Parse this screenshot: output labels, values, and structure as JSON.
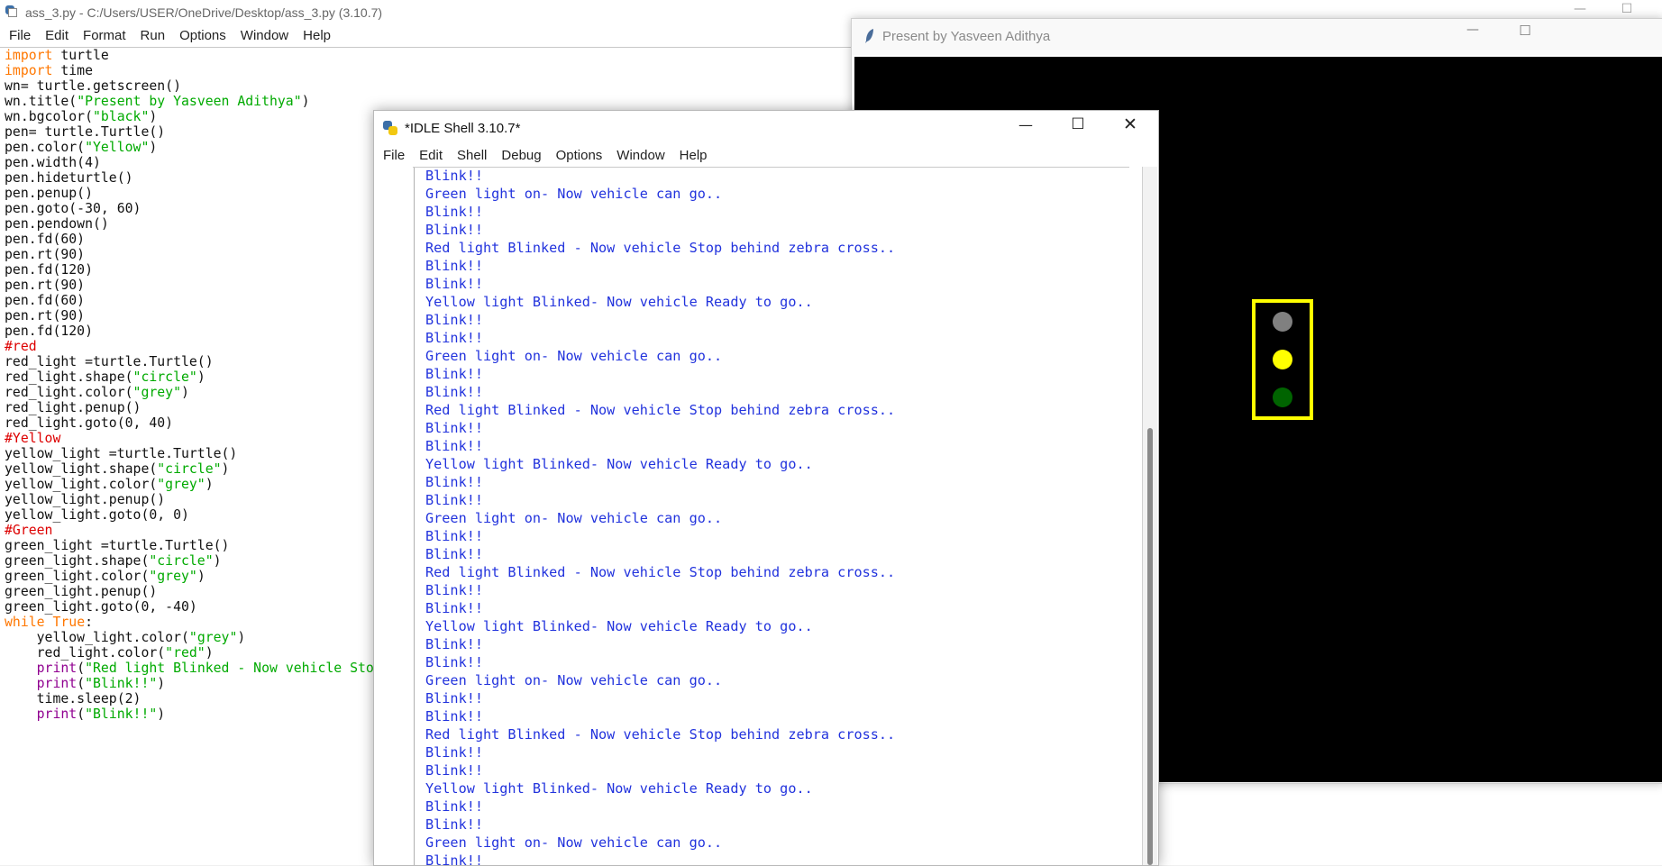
{
  "editor": {
    "title": "ass_3.py - C:/Users/USER/OneDrive/Desktop/ass_3.py (3.10.7)",
    "menu": [
      "File",
      "Edit",
      "Format",
      "Run",
      "Options",
      "Window",
      "Help"
    ],
    "code": [
      [
        [
          "kw",
          "import"
        ],
        [
          "",
          " turtle"
        ]
      ],
      [
        [
          "kw",
          "import"
        ],
        [
          "",
          " time"
        ]
      ],
      [
        [
          "",
          "wn= turtle.getscreen()"
        ]
      ],
      [
        [
          "",
          "wn.title("
        ],
        [
          "str",
          "\"Present by Yasveen Adithya\""
        ],
        [
          "",
          ")"
        ]
      ],
      [
        [
          "",
          "wn.bgcolor("
        ],
        [
          "str",
          "\"black\""
        ],
        [
          "",
          ")"
        ]
      ],
      [
        [
          "",
          "pen= turtle.Turtle()"
        ]
      ],
      [
        [
          "",
          "pen.color("
        ],
        [
          "str",
          "\"Yellow\""
        ],
        [
          "",
          ")"
        ]
      ],
      [
        [
          "",
          "pen.width(4)"
        ]
      ],
      [
        [
          "",
          "pen.hideturtle()"
        ]
      ],
      [
        [
          "",
          "pen.penup()"
        ]
      ],
      [
        [
          "",
          "pen.goto(-30, 60)"
        ]
      ],
      [
        [
          "",
          "pen.pendown()"
        ]
      ],
      [
        [
          "",
          "pen.fd(60)"
        ]
      ],
      [
        [
          "",
          "pen.rt(90)"
        ]
      ],
      [
        [
          "",
          "pen.fd(120)"
        ]
      ],
      [
        [
          "",
          "pen.rt(90)"
        ]
      ],
      [
        [
          "",
          "pen.fd(60)"
        ]
      ],
      [
        [
          "",
          "pen.rt(90)"
        ]
      ],
      [
        [
          "",
          "pen.fd(120)"
        ]
      ],
      [
        [
          "cmt",
          "#red"
        ]
      ],
      [
        [
          "",
          "red_light =turtle.Turtle()"
        ]
      ],
      [
        [
          "",
          "red_light.shape("
        ],
        [
          "str",
          "\"circle\""
        ],
        [
          "",
          ")"
        ]
      ],
      [
        [
          "",
          "red_light.color("
        ],
        [
          "str",
          "\"grey\""
        ],
        [
          "",
          ")"
        ]
      ],
      [
        [
          "",
          "red_light.penup()"
        ]
      ],
      [
        [
          "",
          "red_light.goto(0, 40)"
        ]
      ],
      [
        [
          "cmt",
          "#Yellow"
        ]
      ],
      [
        [
          "",
          "yellow_light =turtle.Turtle()"
        ]
      ],
      [
        [
          "",
          "yellow_light.shape("
        ],
        [
          "str",
          "\"circle\""
        ],
        [
          "",
          ")"
        ]
      ],
      [
        [
          "",
          "yellow_light.color("
        ],
        [
          "str",
          "\"grey\""
        ],
        [
          "",
          ")"
        ]
      ],
      [
        [
          "",
          "yellow_light.penup()"
        ]
      ],
      [
        [
          "",
          "yellow_light.goto(0, 0)"
        ]
      ],
      [
        [
          "cmt",
          "#Green"
        ]
      ],
      [
        [
          "",
          "green_light =turtle.Turtle()"
        ]
      ],
      [
        [
          "",
          "green_light.shape("
        ],
        [
          "str",
          "\"circle\""
        ],
        [
          "",
          ")"
        ]
      ],
      [
        [
          "",
          "green_light.color("
        ],
        [
          "str",
          "\"grey\""
        ],
        [
          "",
          ")"
        ]
      ],
      [
        [
          "",
          "green_light.penup()"
        ]
      ],
      [
        [
          "",
          "green_light.goto(0, -40)"
        ]
      ],
      [
        [
          "kw",
          "while"
        ],
        [
          "",
          " "
        ],
        [
          "kw",
          "True"
        ],
        [
          "",
          ":"
        ]
      ],
      [
        [
          "",
          "    yellow_light.color("
        ],
        [
          "str",
          "\"grey\""
        ],
        [
          "",
          ")"
        ]
      ],
      [
        [
          "",
          "    red_light.color("
        ],
        [
          "str",
          "\"red\""
        ],
        [
          "",
          ")"
        ]
      ],
      [
        [
          "",
          "    "
        ],
        [
          "bi",
          "print"
        ],
        [
          "",
          "("
        ],
        [
          "str",
          "\"Red light Blinked - Now vehicle Stop behind zebra cross..\""
        ],
        [
          "",
          ")"
        ]
      ],
      [
        [
          "",
          "    "
        ],
        [
          "bi",
          "print"
        ],
        [
          "",
          "("
        ],
        [
          "str",
          "\"Blink!!\""
        ],
        [
          "",
          ")"
        ]
      ],
      [
        [
          "",
          "    time.sleep(2)"
        ]
      ],
      [
        [
          "",
          "    "
        ],
        [
          "bi",
          "print"
        ],
        [
          "",
          "("
        ],
        [
          "str",
          "\"Blink!!\""
        ],
        [
          "",
          ")"
        ]
      ]
    ]
  },
  "turtle_window": {
    "title": "Present by Yasveen Adithya",
    "background": "#000000",
    "frame_color": "#ffff00",
    "lights": [
      {
        "name": "red",
        "color": "#808080"
      },
      {
        "name": "yellow",
        "color": "#ffff00"
      },
      {
        "name": "green",
        "color": "#006400"
      }
    ]
  },
  "shell": {
    "title": "*IDLE Shell 3.10.7*",
    "menu": [
      "File",
      "Edit",
      "Shell",
      "Debug",
      "Options",
      "Window",
      "Help"
    ],
    "text_color": "#2233dd",
    "output": [
      "Blink!!",
      "Green light on- Now vehicle can go..",
      "Blink!!",
      "Blink!!",
      "Red light Blinked - Now vehicle Stop behind zebra cross..",
      "Blink!!",
      "Blink!!",
      "Yellow light Blinked- Now vehicle Ready to go..",
      "Blink!!",
      "Blink!!",
      "Green light on- Now vehicle can go..",
      "Blink!!",
      "Blink!!",
      "Red light Blinked - Now vehicle Stop behind zebra cross..",
      "Blink!!",
      "Blink!!",
      "Yellow light Blinked- Now vehicle Ready to go..",
      "Blink!!",
      "Blink!!",
      "Green light on- Now vehicle can go..",
      "Blink!!",
      "Blink!!",
      "Red light Blinked - Now vehicle Stop behind zebra cross..",
      "Blink!!",
      "Blink!!",
      "Yellow light Blinked- Now vehicle Ready to go..",
      "Blink!!",
      "Blink!!",
      "Green light on- Now vehicle can go..",
      "Blink!!",
      "Blink!!",
      "Red light Blinked - Now vehicle Stop behind zebra cross..",
      "Blink!!",
      "Blink!!",
      "Yellow light Blinked- Now vehicle Ready to go..",
      "Blink!!",
      "Blink!!",
      "Green light on- Now vehicle can go..",
      "Blink!!"
    ]
  },
  "icons": {
    "minimize": "minimize-icon",
    "maximize": "maximize-icon",
    "close": "close-icon",
    "python_file": "python-file-icon",
    "feather": "feather-icon"
  }
}
